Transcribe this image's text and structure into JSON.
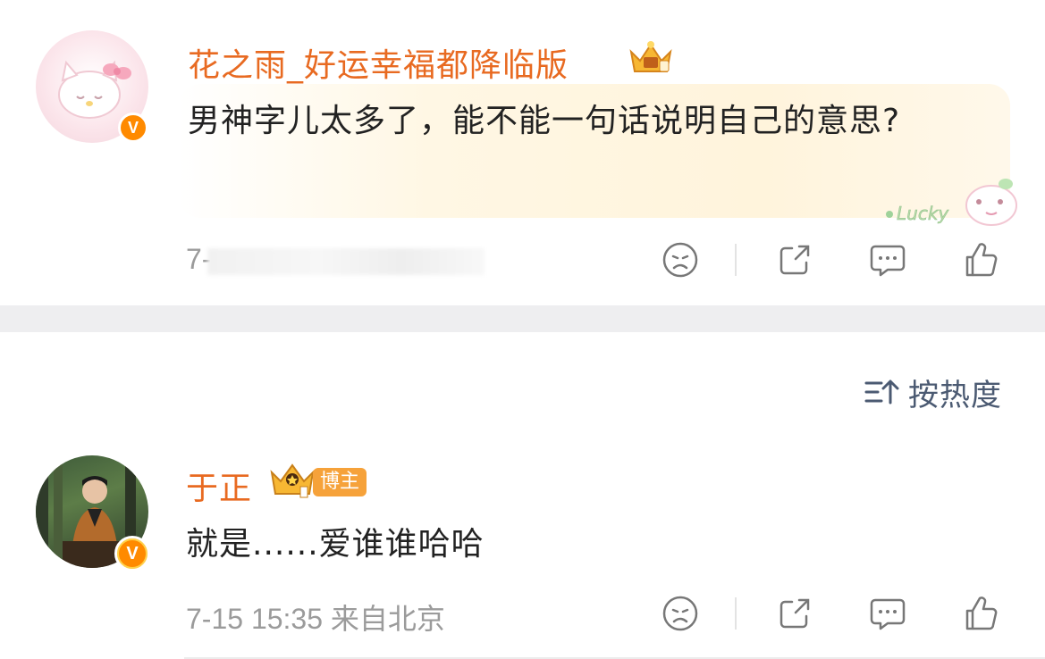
{
  "comment1": {
    "username": "花之雨_好运幸福都降临版",
    "content": "男神字儿太多了，能不能一句话说明自己的意思?",
    "meta_prefix": "7-",
    "badge_letter": "V",
    "sticker_text": "Lucky"
  },
  "sort": {
    "label": "按热度"
  },
  "comment2": {
    "username": "于正",
    "tag": "博主",
    "content": "就是......爱谁谁哈哈",
    "meta": "7-15 15:35 来自北京",
    "badge_letter": "V"
  },
  "colors": {
    "username": "#e86a21",
    "meta": "#9b9b9b",
    "divider": "#eeeef0",
    "sort": "#4b5a72"
  }
}
